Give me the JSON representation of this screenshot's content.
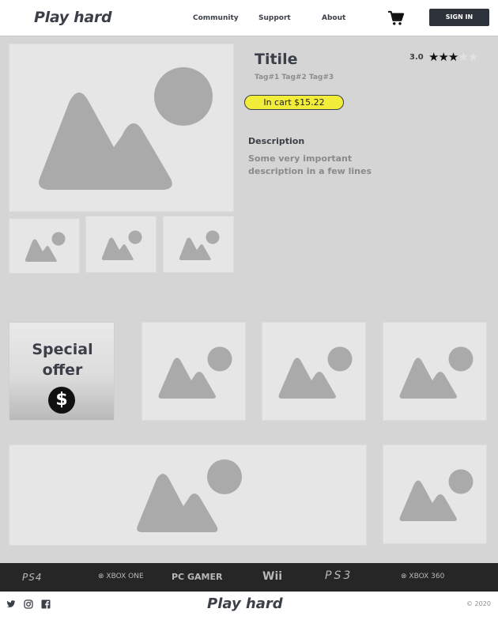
{
  "header": {
    "brand": "Play hard",
    "nav": [
      "Community",
      "Support",
      "About"
    ],
    "cart_icon": "shopping-cart-icon",
    "signin_label": "SIGN IN"
  },
  "product": {
    "title": "Titile",
    "tags": "Tag#1 Tag#2 Tag#3",
    "rating": "3.0",
    "stars_filled": 3,
    "stars_total": 5,
    "cart_label": "In cart $15.22",
    "description_heading": "Description",
    "description_text": "Some very important description in a few lines"
  },
  "special_offer": {
    "label": "Special offer",
    "icon": "dollar-coin-icon"
  },
  "platforms": [
    "PS4",
    "XBOX ONE",
    "PC GAMER",
    "Wii",
    "PS3",
    "XBOX 360"
  ],
  "footer": {
    "brand": "Play hard",
    "social_icons": [
      "twitter-icon",
      "instagram-icon",
      "facebook-icon"
    ],
    "copyright": "© 2020"
  },
  "colors": {
    "accent_badge": "#f2ec3b",
    "dark": "#2c313a",
    "placeholder": "#e6e6e6",
    "placeholder_art": "#aaaaaa"
  }
}
